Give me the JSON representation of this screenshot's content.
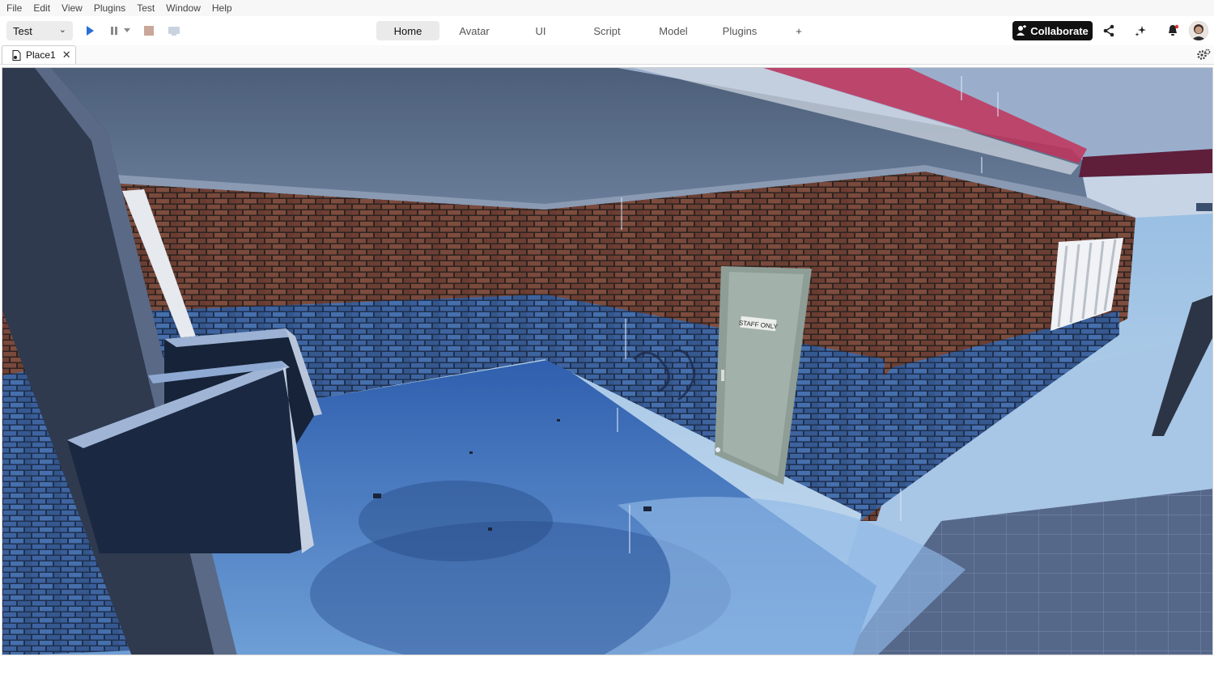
{
  "menu": [
    "File",
    "Edit",
    "View",
    "Plugins",
    "Test",
    "Window",
    "Help"
  ],
  "toolbar": {
    "mode_value": "Test",
    "tabs": [
      "Home",
      "Avatar",
      "UI",
      "Script",
      "Model",
      "Plugins",
      "+"
    ],
    "active_tab": "Home",
    "collaborate_label": "Collaborate"
  },
  "document": {
    "tab_label": "Place1"
  },
  "scene": {
    "door_sign": "STAFF ONLY"
  },
  "colors": {
    "accent_play": "#2b6fd6",
    "collaborate_bg": "#111111",
    "notification_dot": "#e03030"
  }
}
